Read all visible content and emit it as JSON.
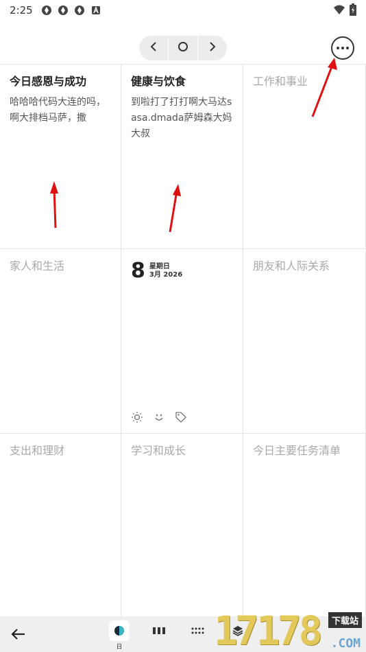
{
  "status": {
    "time": "2:25",
    "icons": [
      "sync-icon",
      "sync-icon",
      "sync-icon",
      "a-box-icon"
    ],
    "right_icons": [
      "wifi-icon",
      "battery-icon"
    ]
  },
  "nav": {
    "prev_icon": "chevron-left-icon",
    "today_icon": "circle-icon",
    "next_icon": "chevron-right-icon",
    "more_icon": "more-horizontal-icon"
  },
  "cells": [
    {
      "title": "今日感恩与成功",
      "body": "哈哈哈代码大连的吗，啊大排档马萨，撒"
    },
    {
      "title": "健康与饮食",
      "body": "到啦打了打打啊大马达sasa.dmada萨姆森大妈大叔"
    },
    {
      "title": "工作和事业",
      "body": ""
    },
    {
      "title": "家人和生活",
      "body": ""
    },
    {
      "date": {
        "day": "8",
        "weekday": "星期日",
        "month_year": "3月 2026"
      }
    },
    {
      "title": "朋友和人际关系",
      "body": ""
    },
    {
      "title": "支出和理财",
      "body": ""
    },
    {
      "title": "学习和成长",
      "body": ""
    },
    {
      "title": "今日主要任务清单",
      "body": ""
    }
  ],
  "center_icons": [
    "sun-icon",
    "smile-icon",
    "tag-icon"
  ],
  "bottom": {
    "back_icon": "back-arrow-icon",
    "day_label": "日",
    "tabs": [
      "day-view-icon",
      "week-view-icon",
      "month-view-icon",
      "layers-icon"
    ]
  },
  "watermark": {
    "number": "17178",
    "site": "下载站",
    "domain": ".COM"
  },
  "colors": {
    "annotation_arrow": "#e01010",
    "grid_line": "#e4e4e4",
    "bottom_bar": "#efefef",
    "empty_title": "#a8a8a8"
  }
}
